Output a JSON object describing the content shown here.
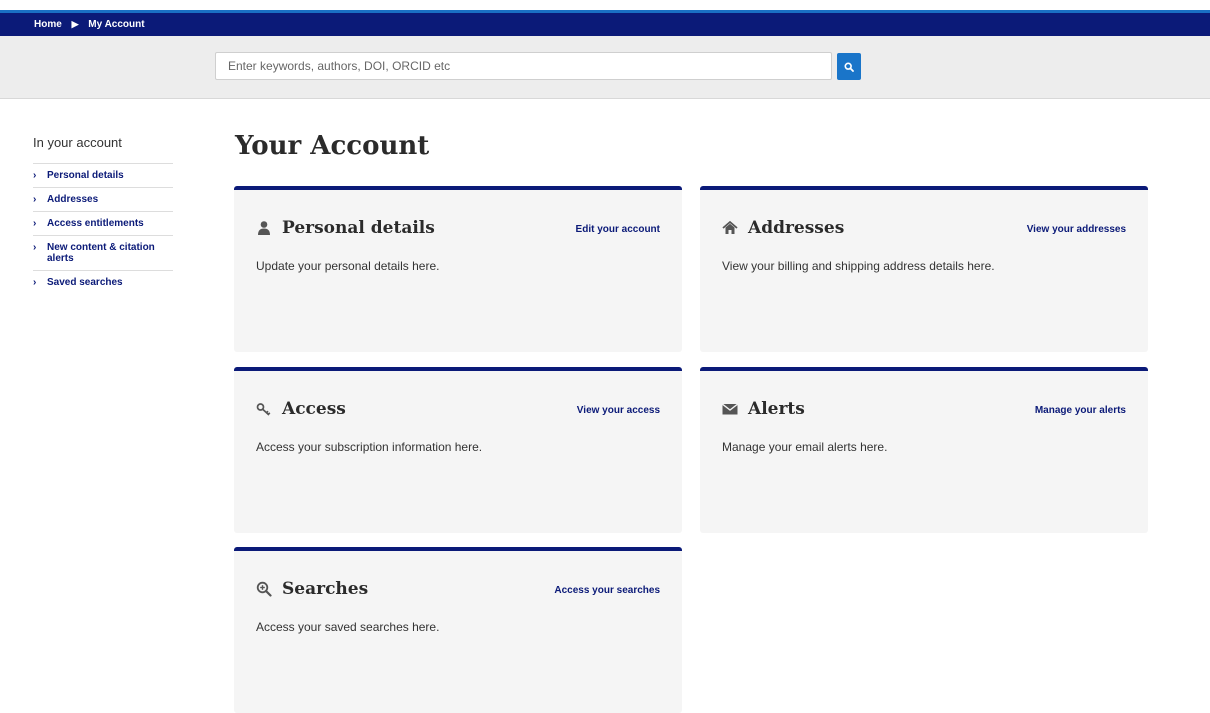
{
  "breadcrumb": {
    "home": "Home",
    "separator": "▶",
    "current": "My Account"
  },
  "search": {
    "placeholder": "Enter keywords, authors, DOI, ORCID etc",
    "button_icon": "search-icon"
  },
  "sidebar": {
    "title": "In your account",
    "items": [
      {
        "label": "Personal details"
      },
      {
        "label": "Addresses"
      },
      {
        "label": "Access entitlements"
      },
      {
        "label": "New content & citation alerts"
      },
      {
        "label": "Saved searches"
      }
    ]
  },
  "page": {
    "title": "Your Account"
  },
  "cards": [
    {
      "title": "Personal details",
      "icon": "user-icon",
      "link": "Edit your account",
      "description": "Update your personal details here."
    },
    {
      "title": "Addresses",
      "icon": "home-icon",
      "link": "View your addresses",
      "description": "View your billing and shipping address details here."
    },
    {
      "title": "Access",
      "icon": "key-icon",
      "link": "View your access",
      "description": "Access your subscription information here."
    },
    {
      "title": "Alerts",
      "icon": "envelope-icon",
      "link": "Manage your alerts",
      "description": "Manage your email alerts here."
    },
    {
      "title": "Searches",
      "icon": "search-plus-icon",
      "link": "Access your searches",
      "description": "Access your saved searches here."
    }
  ],
  "colors": {
    "navy": "#0b1a78",
    "accent_blue": "#1a75c9",
    "card_bg": "#f5f5f5"
  }
}
